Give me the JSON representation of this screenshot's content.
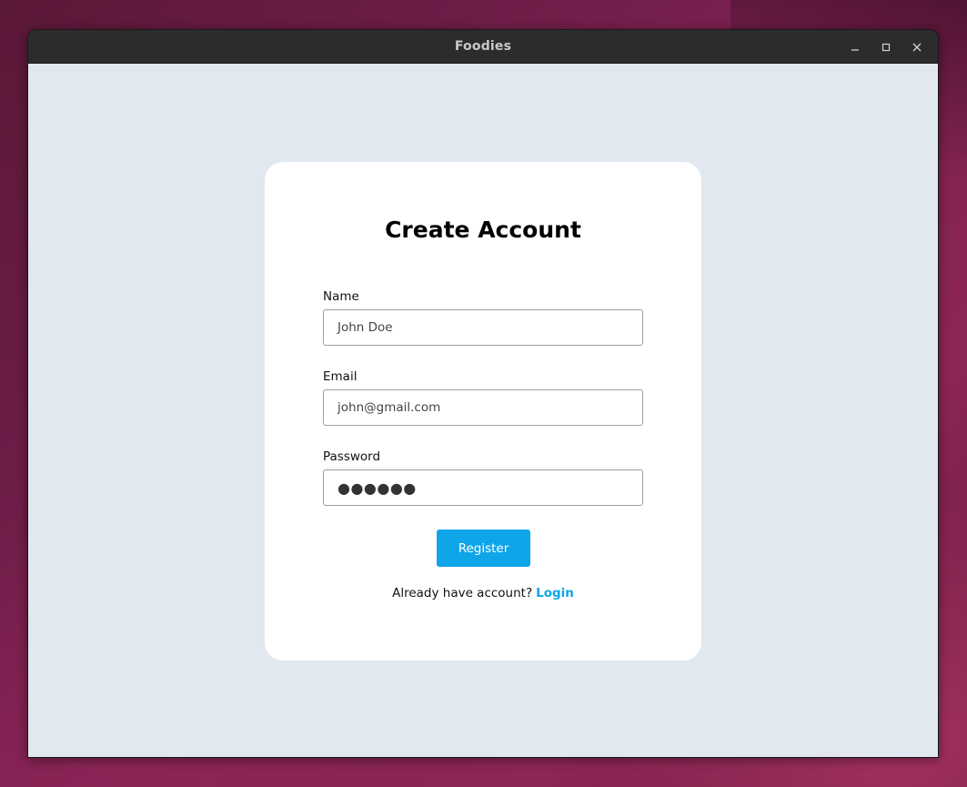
{
  "window": {
    "title": "Foodies",
    "controls": {
      "minimize_icon": "minimize-icon",
      "maximize_icon": "maximize-icon",
      "close_icon": "close-icon"
    }
  },
  "form": {
    "title": "Create Account",
    "fields": {
      "name": {
        "label": "Name",
        "value": "John Doe"
      },
      "email": {
        "label": "Email",
        "value": "john@gmail.com"
      },
      "password": {
        "label": "Password",
        "value": "●●●●●●"
      }
    },
    "register_label": "Register",
    "footer_text": "Already have account?",
    "login_label": "Login"
  },
  "colors": {
    "accent": "#0ea5e9",
    "background": "#e2e8f0",
    "card": "#ffffff",
    "titlebar": "#2c2c2c"
  }
}
